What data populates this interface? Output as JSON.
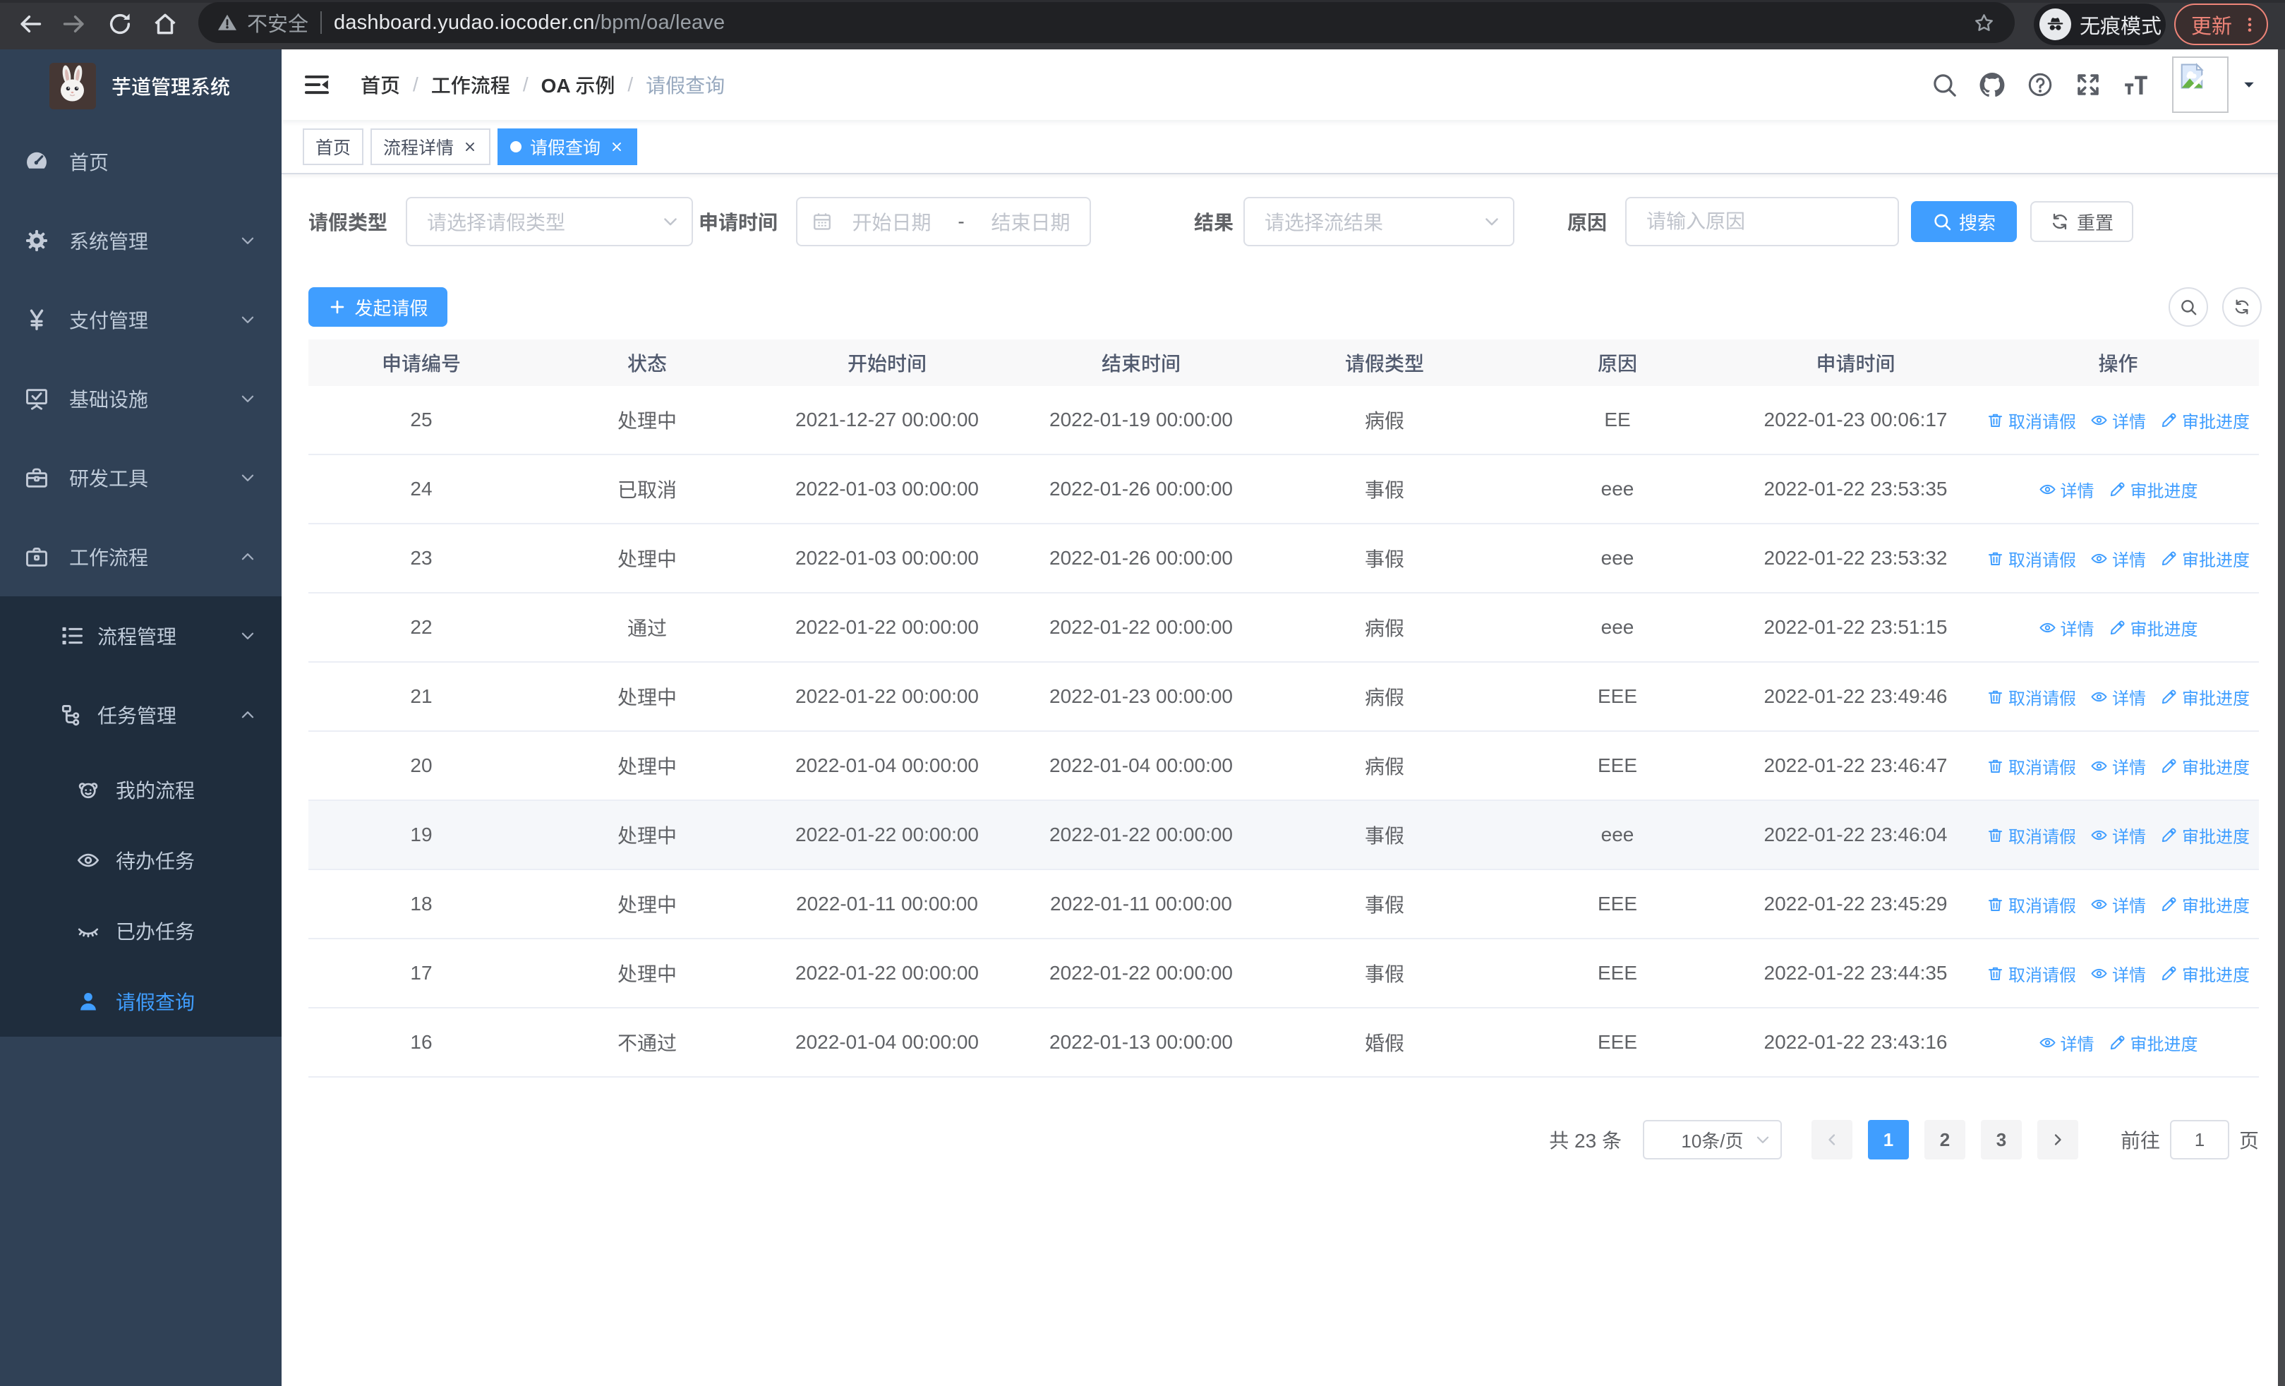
{
  "browser": {
    "security_label": "不安全",
    "url_host": "dashboard.yudao.iocoder.cn",
    "url_path": "/bpm/oa/leave",
    "incognito_label": "无痕模式",
    "update_label": "更新"
  },
  "sidebar": {
    "logo_title": "芋道管理系统",
    "menu": [
      {
        "label": "首页",
        "icon": "dashboard-icon",
        "level": 1,
        "arrow": "",
        "active": false
      },
      {
        "label": "系统管理",
        "icon": "gear-icon",
        "level": 1,
        "arrow": "down",
        "active": false
      },
      {
        "label": "支付管理",
        "icon": "yen-icon",
        "level": 1,
        "arrow": "down",
        "active": false
      },
      {
        "label": "基础设施",
        "icon": "monitor-icon",
        "level": 1,
        "arrow": "down",
        "active": false
      },
      {
        "label": "研发工具",
        "icon": "toolbox-icon",
        "level": 1,
        "arrow": "down",
        "active": false
      },
      {
        "label": "工作流程",
        "icon": "briefcase-icon",
        "level": 1,
        "arrow": "up",
        "active": false
      },
      {
        "label": "流程管理",
        "icon": "tree-list-icon",
        "level": 2,
        "arrow": "down",
        "active": false
      },
      {
        "label": "任务管理",
        "icon": "org-icon",
        "level": 2,
        "arrow": "up",
        "active": false
      },
      {
        "label": "我的流程",
        "icon": "face-icon",
        "level": 3,
        "arrow": "",
        "active": false
      },
      {
        "label": "待办任务",
        "icon": "eye-icon",
        "level": 3,
        "arrow": "",
        "active": false
      },
      {
        "label": "已办任务",
        "icon": "eye-closed-icon",
        "level": 3,
        "arrow": "",
        "active": false
      },
      {
        "label": "请假查询",
        "icon": "user-icon",
        "level": 3,
        "arrow": "",
        "active": true
      }
    ]
  },
  "header": {
    "breadcrumb": [
      {
        "label": "首页",
        "current": false
      },
      {
        "label": "工作流程",
        "current": false
      },
      {
        "label": "OA 示例",
        "current": false
      },
      {
        "label": "请假查询",
        "current": true
      }
    ]
  },
  "tags": [
    {
      "label": "首页",
      "closable": false,
      "active": false
    },
    {
      "label": "流程详情",
      "closable": true,
      "active": false
    },
    {
      "label": "请假查询",
      "closable": true,
      "active": true
    }
  ],
  "filters": {
    "leave_type": {
      "label": "请假类型",
      "placeholder": "请选择请假类型"
    },
    "apply_time": {
      "label": "申请时间",
      "start_placeholder": "开始日期",
      "separator": "-",
      "end_placeholder": "结束日期"
    },
    "result": {
      "label": "结果",
      "placeholder": "请选择流结果"
    },
    "reason": {
      "label": "原因",
      "placeholder": "请输入原因"
    },
    "search_label": "搜索",
    "reset_label": "重置"
  },
  "toolbar": {
    "create_label": "发起请假"
  },
  "table": {
    "columns": [
      "申请编号",
      "状态",
      "开始时间",
      "结束时间",
      "请假类型",
      "原因",
      "申请时间",
      "操作"
    ],
    "action_defs": {
      "cancel": {
        "label": "取消请假",
        "icon": "delete-icon"
      },
      "detail": {
        "label": "详情",
        "icon": "view-icon"
      },
      "progress": {
        "label": "审批进度",
        "icon": "edit-icon"
      }
    },
    "rows": [
      {
        "id": "25",
        "status": "处理中",
        "start": "2021-12-27 00:00:00",
        "end": "2022-01-19 00:00:00",
        "type": "病假",
        "reason": "EE",
        "apply": "2022-01-23 00:06:17",
        "actions": [
          "cancel",
          "detail",
          "progress"
        ],
        "highlighted": false
      },
      {
        "id": "24",
        "status": "已取消",
        "start": "2022-01-03 00:00:00",
        "end": "2022-01-26 00:00:00",
        "type": "事假",
        "reason": "eee",
        "apply": "2022-01-22 23:53:35",
        "actions": [
          "detail",
          "progress"
        ],
        "highlighted": false
      },
      {
        "id": "23",
        "status": "处理中",
        "start": "2022-01-03 00:00:00",
        "end": "2022-01-26 00:00:00",
        "type": "事假",
        "reason": "eee",
        "apply": "2022-01-22 23:53:32",
        "actions": [
          "cancel",
          "detail",
          "progress"
        ],
        "highlighted": false
      },
      {
        "id": "22",
        "status": "通过",
        "start": "2022-01-22 00:00:00",
        "end": "2022-01-22 00:00:00",
        "type": "病假",
        "reason": "eee",
        "apply": "2022-01-22 23:51:15",
        "actions": [
          "detail",
          "progress"
        ],
        "highlighted": false
      },
      {
        "id": "21",
        "status": "处理中",
        "start": "2022-01-22 00:00:00",
        "end": "2022-01-23 00:00:00",
        "type": "病假",
        "reason": "EEE",
        "apply": "2022-01-22 23:49:46",
        "actions": [
          "cancel",
          "detail",
          "progress"
        ],
        "highlighted": false
      },
      {
        "id": "20",
        "status": "处理中",
        "start": "2022-01-04 00:00:00",
        "end": "2022-01-04 00:00:00",
        "type": "病假",
        "reason": "EEE",
        "apply": "2022-01-22 23:46:47",
        "actions": [
          "cancel",
          "detail",
          "progress"
        ],
        "highlighted": false
      },
      {
        "id": "19",
        "status": "处理中",
        "start": "2022-01-22 00:00:00",
        "end": "2022-01-22 00:00:00",
        "type": "事假",
        "reason": "eee",
        "apply": "2022-01-22 23:46:04",
        "actions": [
          "cancel",
          "detail",
          "progress"
        ],
        "highlighted": true
      },
      {
        "id": "18",
        "status": "处理中",
        "start": "2022-01-11 00:00:00",
        "end": "2022-01-11 00:00:00",
        "type": "事假",
        "reason": "EEE",
        "apply": "2022-01-22 23:45:29",
        "actions": [
          "cancel",
          "detail",
          "progress"
        ],
        "highlighted": false
      },
      {
        "id": "17",
        "status": "处理中",
        "start": "2022-01-22 00:00:00",
        "end": "2022-01-22 00:00:00",
        "type": "事假",
        "reason": "EEE",
        "apply": "2022-01-22 23:44:35",
        "actions": [
          "cancel",
          "detail",
          "progress"
        ],
        "highlighted": false
      },
      {
        "id": "16",
        "status": "不通过",
        "start": "2022-01-04 00:00:00",
        "end": "2022-01-13 00:00:00",
        "type": "婚假",
        "reason": "EEE",
        "apply": "2022-01-22 23:43:16",
        "actions": [
          "detail",
          "progress"
        ],
        "highlighted": false
      }
    ]
  },
  "pagination": {
    "total_label": "共 23 条",
    "page_size_label": "10条/页",
    "pages": [
      "1",
      "2",
      "3"
    ],
    "active_page": "1",
    "jump_prefix": "前往",
    "jump_value": "1",
    "jump_suffix": "页"
  },
  "colors": {
    "primary": "#409EFF",
    "sidebar_bg": "#304156",
    "submenu_bg": "#1f2d3d",
    "sidebar_text": "#bfcbd9",
    "table_border": "#ebeef5",
    "header_bg": "#f8f8f9"
  }
}
